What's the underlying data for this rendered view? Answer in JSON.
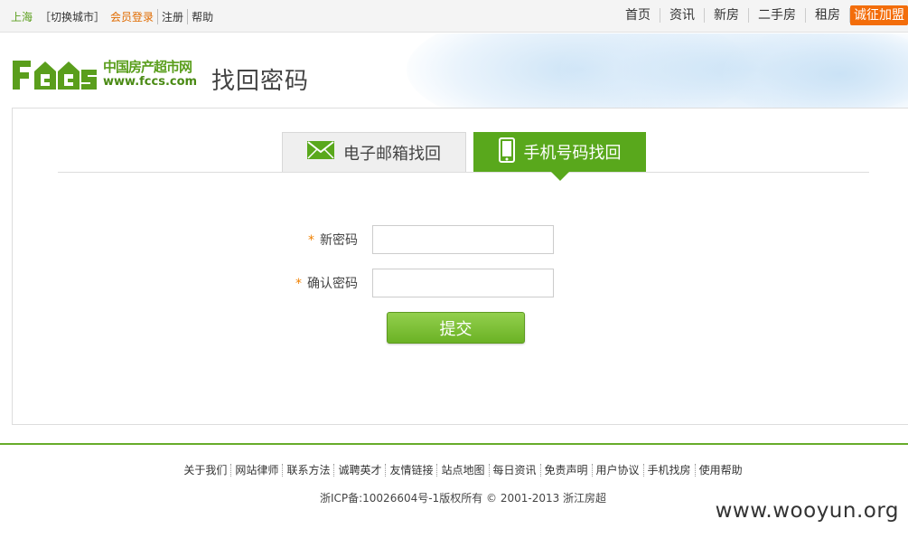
{
  "topbar": {
    "city": "上海",
    "switch_city": "［切换城市］",
    "login": "会员登录",
    "register": "注册",
    "help": "帮助",
    "nav": [
      "首页",
      "资讯",
      "新房",
      "二手房",
      "租房"
    ],
    "join": "诚征加盟"
  },
  "header": {
    "logo_cn": "中国房产超市网",
    "logo_url": "www.fccs.com",
    "page_title": "找回密码"
  },
  "tabs": {
    "email": "电子邮箱找回",
    "phone": "手机号码找回"
  },
  "form": {
    "required_mark": "*",
    "new_password_label": "新密码",
    "confirm_password_label": "确认密码",
    "new_password_value": "",
    "confirm_password_value": "",
    "submit": "提交"
  },
  "footer": {
    "links": [
      "关于我们",
      "网站律师",
      "联系方法",
      "诚聘英才",
      "友情链接",
      "站点地图",
      "每日资讯",
      "免责声明",
      "用户协议",
      "手机找房",
      "使用帮助"
    ],
    "copyright": "浙ICP备:10026604号-1版权所有 © 2001-2013 浙江房超"
  },
  "watermark": "www.wooyun.org",
  "colors": {
    "brand_green": "#59a81c",
    "accent_orange": "#f36d0a",
    "footer_line": "#67ac2a"
  },
  "icons": {
    "email_tab": "envelope-icon",
    "phone_tab": "mobile-phone-icon"
  }
}
